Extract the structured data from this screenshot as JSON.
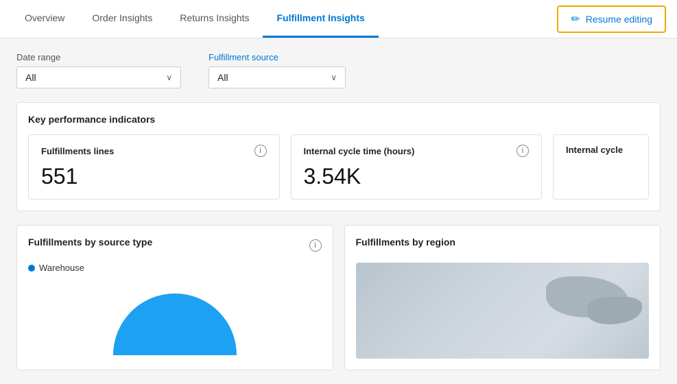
{
  "nav": {
    "tabs": [
      {
        "id": "overview",
        "label": "Overview",
        "active": false
      },
      {
        "id": "order-insights",
        "label": "Order Insights",
        "active": false
      },
      {
        "id": "returns-insights",
        "label": "Returns Insights",
        "active": false
      },
      {
        "id": "fulfillment-insights",
        "label": "Fulfillment Insights",
        "active": true
      }
    ],
    "resume_editing_label": "Resume editing"
  },
  "filters": {
    "date_range": {
      "label": "Date range",
      "value": "All"
    },
    "fulfillment_source": {
      "label": "Fulfillment source",
      "value": "All"
    }
  },
  "kpi": {
    "section_title": "Key performance indicators",
    "cards": [
      {
        "id": "fulfillment-lines",
        "title": "Fulfillments lines",
        "value": "551"
      },
      {
        "id": "internal-cycle-time",
        "title": "Internal cycle time (hours)",
        "value": "3.54K"
      },
      {
        "id": "internal-cycle-partial",
        "title": "Internal cycle",
        "value": ""
      }
    ]
  },
  "bottom": {
    "fulfillments_by_source": {
      "title": "Fulfillments by source type",
      "legend": [
        {
          "label": "Warehouse",
          "color": "#1da1f2"
        }
      ]
    },
    "fulfillments_by_region": {
      "title": "Fulfillments by region"
    }
  },
  "icons": {
    "chevron_down": "∨",
    "info": "i",
    "pencil": "✏"
  }
}
